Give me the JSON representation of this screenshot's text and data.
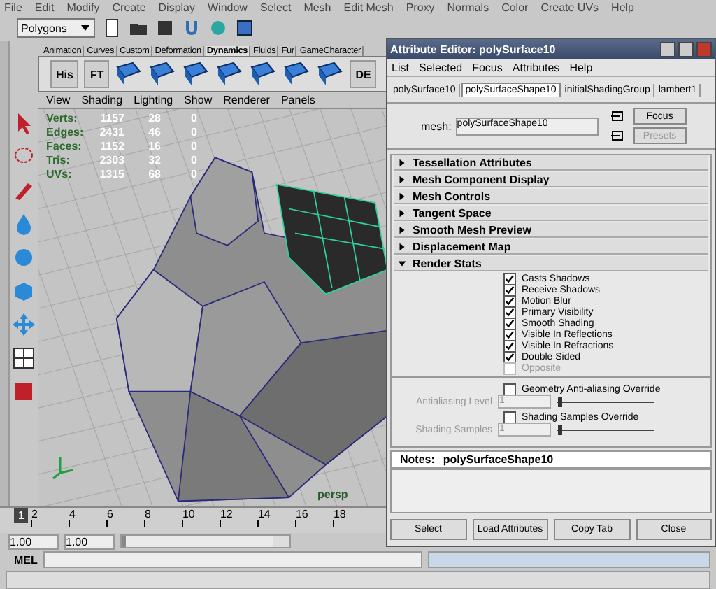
{
  "menu_bar": [
    "File",
    "Edit",
    "Modify",
    "Create",
    "Display",
    "Window",
    "Select",
    "Mesh",
    "Edit Mesh",
    "Proxy",
    "Normals",
    "Color",
    "Create UVs",
    "Help"
  ],
  "mode_selector": {
    "value": "Polygons"
  },
  "shelf_tabs": [
    {
      "label": "Animation",
      "selected": false
    },
    {
      "label": "Curves",
      "selected": false
    },
    {
      "label": "Custom",
      "selected": false
    },
    {
      "label": "Deformation",
      "selected": false
    },
    {
      "label": "Dynamics",
      "selected": true
    },
    {
      "label": "Fluids",
      "selected": false
    },
    {
      "label": "Fur",
      "selected": false
    },
    {
      "label": "GameCharacter",
      "selected": false
    }
  ],
  "shelf_buttons": [
    {
      "kind": "labeled",
      "label": "His"
    },
    {
      "kind": "labeled",
      "label": "FT"
    },
    {
      "kind": "icon"
    },
    {
      "kind": "icon"
    },
    {
      "kind": "icon"
    },
    {
      "kind": "icon"
    },
    {
      "kind": "icon"
    },
    {
      "kind": "icon"
    },
    {
      "kind": "icon"
    },
    {
      "kind": "labeled",
      "label": "DE"
    }
  ],
  "viewport": {
    "menu": [
      "View",
      "Shading",
      "Lighting",
      "Show",
      "Renderer",
      "Panels"
    ],
    "hud": [
      {
        "label": "Verts:",
        "values": [
          "1157",
          "28",
          "0"
        ]
      },
      {
        "label": "Edges:",
        "values": [
          "2431",
          "46",
          "0"
        ]
      },
      {
        "label": "Faces:",
        "values": [
          "1152",
          "16",
          "0"
        ]
      },
      {
        "label": "Tris:",
        "values": [
          "2303",
          "32",
          "0"
        ]
      },
      {
        "label": "UVs:",
        "values": [
          "1315",
          "68",
          "0"
        ]
      }
    ],
    "camera_label": "persp"
  },
  "timeline": {
    "current_frame": "1",
    "ticks": [
      "2",
      "4",
      "6",
      "8",
      "10",
      "12",
      "14",
      "16",
      "18"
    ],
    "range_start": "1.00",
    "range_current": "1.00",
    "range_slider": {
      "level": 0.9
    }
  },
  "command_line": {
    "label": "MEL"
  },
  "attribute_editor": {
    "title": "Attribute Editor: polySurface10",
    "menu": [
      "List",
      "Selected",
      "Focus",
      "Attributes",
      "Help"
    ],
    "tabs": [
      {
        "label": "polySurface10",
        "selected": false
      },
      {
        "label": "polySurfaceShape10",
        "selected": true
      },
      {
        "label": "initialShadingGroup",
        "selected": false
      },
      {
        "label": "lambert1",
        "selected": false
      }
    ],
    "node_label": "mesh:",
    "node_value": "polySurfaceShape10",
    "side_buttons": [
      {
        "label": "Focus",
        "disabled": false
      },
      {
        "label": "Presets",
        "disabled": true
      }
    ],
    "sections": [
      {
        "title": "Tessellation Attributes",
        "expanded": false
      },
      {
        "title": "Mesh Component Display",
        "expanded": false
      },
      {
        "title": "Mesh Controls",
        "expanded": false
      },
      {
        "title": "Tangent Space",
        "expanded": false
      },
      {
        "title": "Smooth Mesh Preview",
        "expanded": false
      },
      {
        "title": "Displacement Map",
        "expanded": false
      },
      {
        "title": "Render Stats",
        "expanded": true
      }
    ],
    "render_stats": [
      {
        "label": "Casts Shadows",
        "checked": true,
        "disabled": false
      },
      {
        "label": "Receive Shadows",
        "checked": true,
        "disabled": false
      },
      {
        "label": "Motion Blur",
        "checked": true,
        "disabled": false
      },
      {
        "label": "Primary Visibility",
        "checked": true,
        "disabled": false
      },
      {
        "label": "Smooth Shading",
        "checked": true,
        "disabled": false
      },
      {
        "label": "Visible In Reflections",
        "checked": true,
        "disabled": false
      },
      {
        "label": "Visible In Refractions",
        "checked": true,
        "disabled": false
      },
      {
        "label": "Double Sided",
        "checked": true,
        "disabled": false
      },
      {
        "label": "Opposite",
        "checked": false,
        "disabled": true
      }
    ],
    "overrides": [
      {
        "label": "Geometry Anti-aliasing Override",
        "checked": false,
        "field_label": "Antialiasing Level",
        "field_value": "1",
        "level": 0.02
      },
      {
        "label": "Shading Samples Override",
        "checked": false,
        "field_label": "Shading Samples",
        "field_value": "1",
        "level": 0.02
      }
    ],
    "notes_label": "Notes:",
    "notes_value": "polySurfaceShape10",
    "buttons": [
      "Select",
      "Load Attributes",
      "Copy Tab",
      "Close"
    ]
  }
}
